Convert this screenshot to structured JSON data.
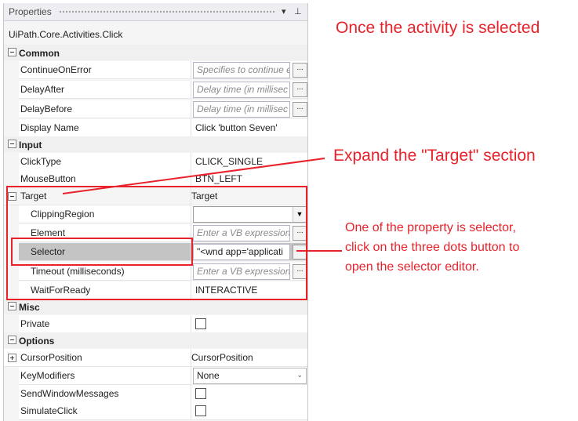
{
  "panel": {
    "title": "Properties",
    "pin_glyph": "⊥",
    "dropdown_glyph": "▾",
    "subject": "UiPath.Core.Activities.Click"
  },
  "categories": {
    "common": "Common",
    "input": "Input",
    "misc": "Misc",
    "options": "Options"
  },
  "props": {
    "continue_on_error": {
      "name": "ContinueOnError",
      "placeholder": "Specifies to continue e"
    },
    "delay_after": {
      "name": "DelayAfter",
      "placeholder": "Delay time (in millisec"
    },
    "delay_before": {
      "name": "DelayBefore",
      "placeholder": "Delay time (in millisec"
    },
    "display_name": {
      "name": "Display Name",
      "value": "Click 'button  Seven'"
    },
    "click_type": {
      "name": "ClickType",
      "value": "CLICK_SINGLE"
    },
    "mouse_button": {
      "name": "MouseButton",
      "value": "BTN_LEFT"
    },
    "target": {
      "name": "Target",
      "value": "Target"
    },
    "clipping_region": {
      "name": "ClippingRegion",
      "value": ""
    },
    "element": {
      "name": "Element",
      "placeholder": "Enter a VB expression"
    },
    "selector": {
      "name": "Selector",
      "value": "\"<wnd app='applicati"
    },
    "timeout": {
      "name": "Timeout (milliseconds)",
      "placeholder": "Enter a VB expression"
    },
    "wait_for_ready": {
      "name": "WaitForReady",
      "value": "INTERACTIVE"
    },
    "private": {
      "name": "Private"
    },
    "cursor_position": {
      "name": "CursorPosition",
      "value": "CursorPosition"
    },
    "key_modifiers": {
      "name": "KeyModifiers",
      "value": "None"
    },
    "send_window_messages": {
      "name": "SendWindowMessages"
    },
    "simulate_click": {
      "name": "SimulateClick"
    }
  },
  "ellipsis": "...",
  "annotations": {
    "top": "Once the activity is selected",
    "target": "Expand the \"Target\" section",
    "selector_1": "One of the property is selector,",
    "selector_2": "click on the three dots button to",
    "selector_3": "open the selector editor."
  },
  "colors": {
    "annotation": "#e8222a",
    "selected_row": "#c4c4c4"
  }
}
